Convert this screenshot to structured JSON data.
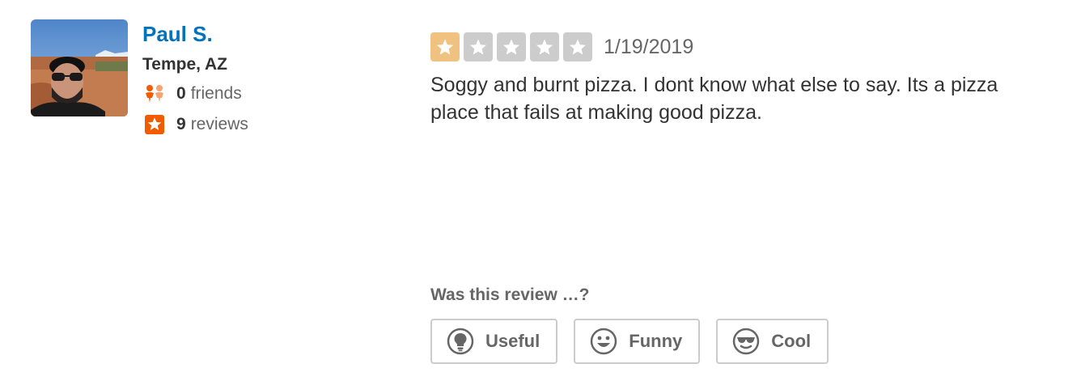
{
  "reviewer": {
    "name": "Paul S.",
    "location": "Tempe, AZ",
    "friends_count": "0",
    "friends_label": "friends",
    "reviews_count": "9",
    "reviews_label": "reviews"
  },
  "review": {
    "rating": 1,
    "max_rating": 5,
    "date": "1/19/2019",
    "text": "Soggy and burnt pizza. I dont know what else to say. Its a pizza place that fails at making good pizza."
  },
  "votes": {
    "prompt": "Was this review …?",
    "buttons": [
      {
        "label": "Useful",
        "icon": "lightbulb-icon"
      },
      {
        "label": "Funny",
        "icon": "smiley-icon"
      },
      {
        "label": "Cool",
        "icon": "sunglasses-icon"
      }
    ]
  },
  "colors": {
    "name_link": "#0073bb",
    "star_filled": "#f0c27f",
    "star_empty": "#cccccc",
    "friends_icon": "#f15c00",
    "reviews_icon": "#f15c00"
  }
}
